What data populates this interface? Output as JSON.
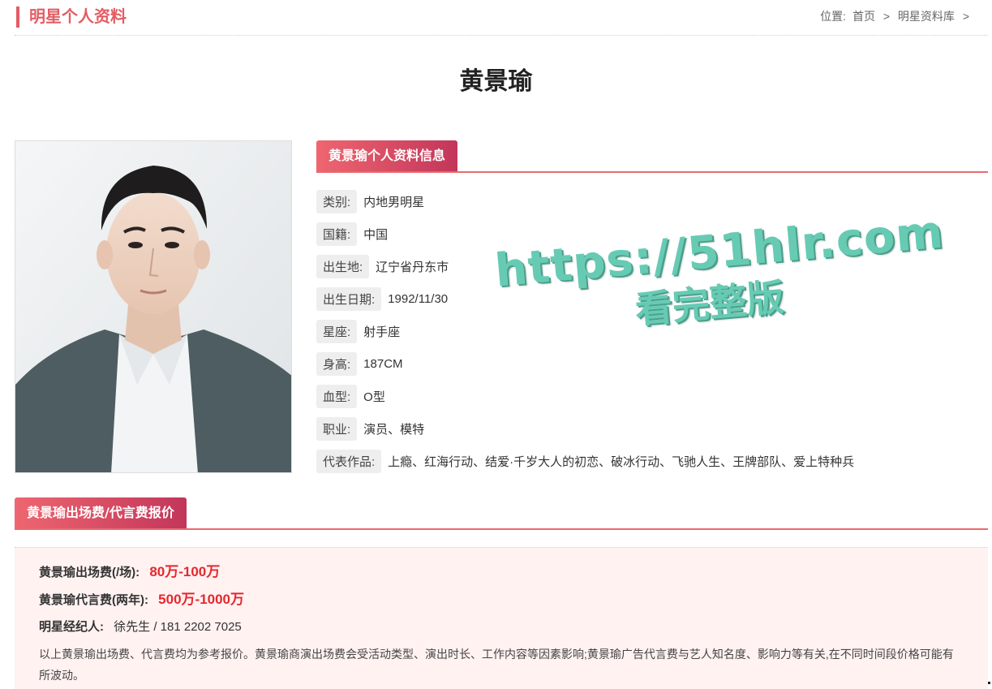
{
  "header": {
    "section_title": "明星个人资料",
    "breadcrumb": {
      "prefix": "位置:",
      "items": [
        "首页",
        "明星资料库"
      ],
      "separator": ">"
    }
  },
  "star": {
    "name": "黄景瑜"
  },
  "profile_tab": {
    "title": "黄景瑜个人资料信息"
  },
  "info": [
    {
      "label": "类别:",
      "value": "内地男明星"
    },
    {
      "label": "国籍:",
      "value": "中国"
    },
    {
      "label": "出生地:",
      "value": "辽宁省丹东市"
    },
    {
      "label": "出生日期:",
      "value": "1992/11/30"
    },
    {
      "label": "星座:",
      "value": "射手座"
    },
    {
      "label": "身高:",
      "value": "187CM"
    },
    {
      "label": "血型:",
      "value": "O型"
    },
    {
      "label": "职业:",
      "value": "演员、模特"
    },
    {
      "label": "代表作品:",
      "value": "上瘾、红海行动、结爱·千岁大人的初恋、破冰行动、飞驰人生、王牌部队、爱上特种兵"
    }
  ],
  "watermark": {
    "line1": "https://51hlr.com",
    "line2": "看完整版"
  },
  "price_tab": {
    "title": "黄景瑜出场费/代言费报价"
  },
  "prices": {
    "appearance_label": "黄景瑜出场费(/场):",
    "appearance_value": "80万-100万",
    "endorsement_label": "黄景瑜代言费(两年):",
    "endorsement_value": "500万-1000万",
    "agent_label": "明星经纪人:",
    "agent_value": "徐先生 / 181 2202 7025",
    "note": "以上黄景瑜出场费、代言费均为参考报价。黄景瑜商演出场费会受活动类型、演出时长、工作内容等因素影响;黄景瑜广告代言费与艺人知名度、影响力等有关,在不同时间段价格可能有所波动。"
  },
  "colors": {
    "accent": "#e25d63",
    "price_red": "#e4282e",
    "watermark": "#67cbb4",
    "price_bg": "#fff2f1"
  }
}
